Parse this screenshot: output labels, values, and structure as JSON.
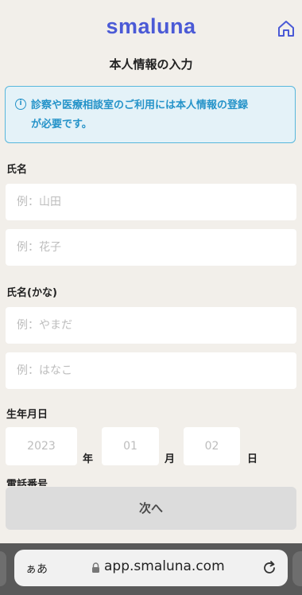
{
  "header": {
    "logo_text": "smaluna",
    "home_icon": "home-icon"
  },
  "page": {
    "title": "本人情報の入力"
  },
  "notice": {
    "icon": "info-icon",
    "icon_glyph": "i",
    "line1": "診察や医療相談室のご利用には本人情報の登録",
    "line2": "が必要です。",
    "color": "#2593c9"
  },
  "form": {
    "name_label": "氏名",
    "last_name_placeholder": "例：山田",
    "first_name_placeholder": "例：花子",
    "kana_label": "氏名(かな)",
    "last_kana_placeholder": "例：やまだ",
    "first_kana_placeholder": "例：はなこ",
    "birth_label": "生年月日",
    "year_value": "2023",
    "year_unit": "年",
    "month_value": "01",
    "month_unit": "月",
    "day_value": "02",
    "day_unit": "日",
    "phone_label": "電話番号"
  },
  "next_button": "次へ",
  "browser": {
    "aa_label": "ぁあ",
    "url": "app.smaluna.com",
    "lock_icon": "lock-icon",
    "reload_icon": "reload-icon"
  },
  "colors": {
    "brand": "#4b5ad6",
    "notice_border": "#58b7dc",
    "notice_bg": "#e4f2f8"
  }
}
